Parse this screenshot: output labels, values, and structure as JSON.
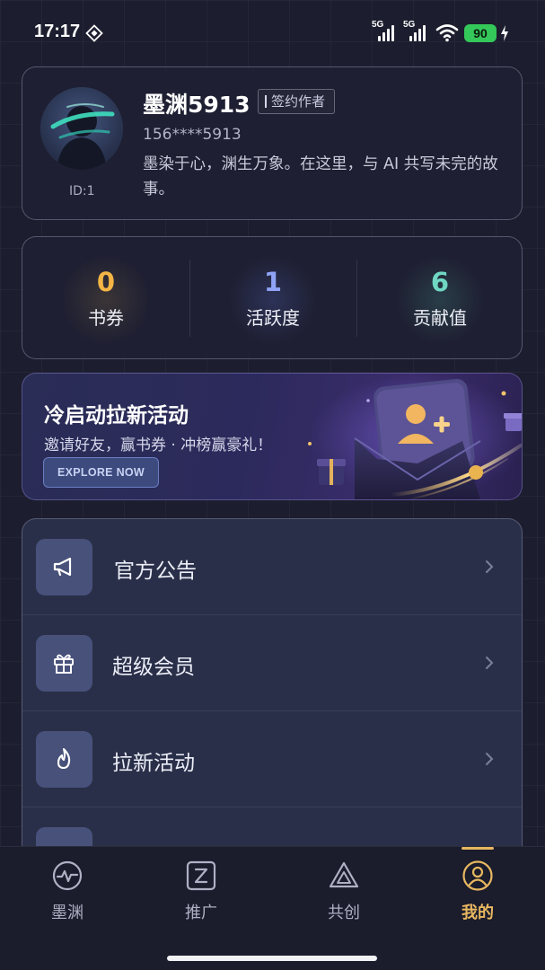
{
  "status_bar": {
    "time": "17:17",
    "signal1_label": "5G",
    "signal2_label": "5G",
    "battery_level": "90",
    "battery_color": "#34c759"
  },
  "profile": {
    "name": "墨渊5913",
    "badge": "签约作者",
    "phone": "156****5913",
    "bio": "墨染于心，渊生万象。在这里，与 AI 共写未完的故事。",
    "id_label": "ID:1"
  },
  "stats": [
    {
      "value": "0",
      "label": "书券",
      "color": "#f2b545"
    },
    {
      "value": "1",
      "label": "活跃度",
      "color": "#8fa2f5"
    },
    {
      "value": "6",
      "label": "贡献值",
      "color": "#6fd7c2"
    }
  ],
  "banner": {
    "title": "冷启动拉新活动",
    "subtitle": "邀请好友，赢书券 · 冲榜赢豪礼！",
    "button": "EXPLORE NOW"
  },
  "menu": [
    {
      "label": "官方公告",
      "icon": "megaphone-icon"
    },
    {
      "label": "超级会员",
      "icon": "gift-icon"
    },
    {
      "label": "拉新活动",
      "icon": "flame-icon"
    }
  ],
  "nav": [
    {
      "label": "墨渊",
      "icon": "pulse-icon",
      "active": false
    },
    {
      "label": "推广",
      "icon": "z-square-icon",
      "active": false
    },
    {
      "label": "共创",
      "icon": "triangle-icon",
      "active": false
    },
    {
      "label": "我的",
      "icon": "user-icon",
      "active": true
    }
  ],
  "colors": {
    "accent": "#e8b860",
    "background": "#1c1d2e"
  }
}
